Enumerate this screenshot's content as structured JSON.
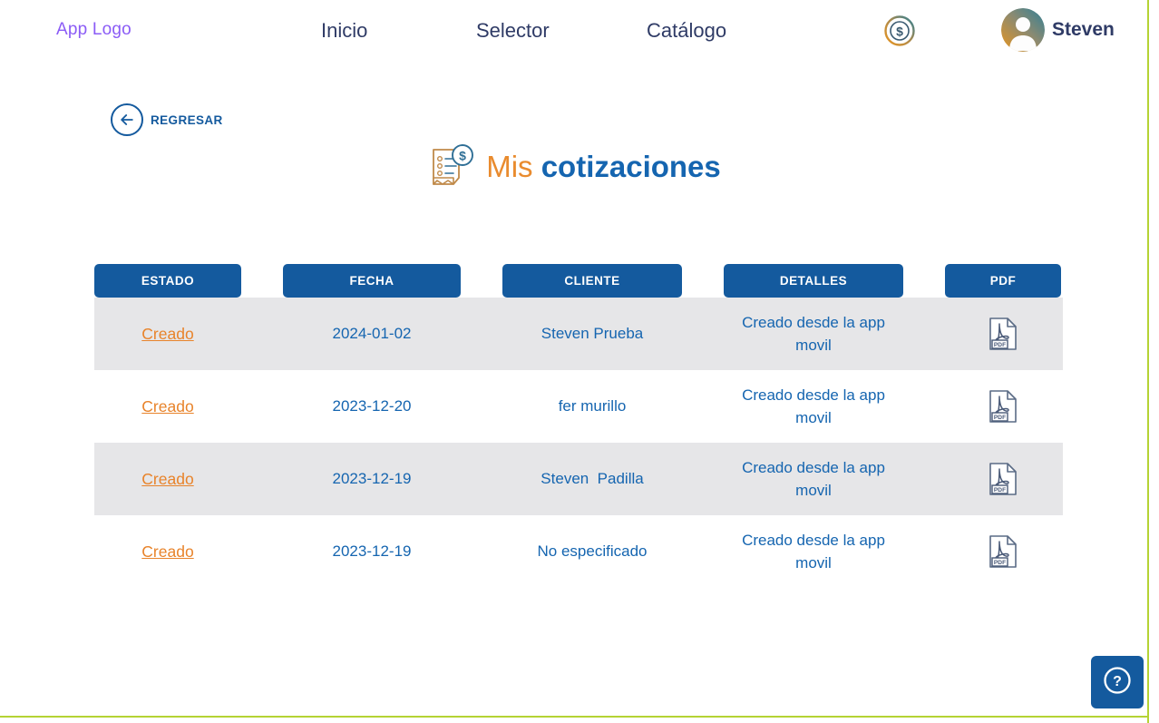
{
  "navbar": {
    "logo": "App Logo",
    "links": [
      {
        "label": "Inicio"
      },
      {
        "label": "Selector"
      },
      {
        "label": "Catálogo"
      }
    ],
    "coin_icon": "dollar-coin-icon",
    "avatar_icon": "user-avatar",
    "user_name": "Steven"
  },
  "back": {
    "label": "REGRESAR",
    "icon": "arrow-left-icon"
  },
  "title": {
    "icon": "invoice-dollar-icon",
    "light": "Mis ",
    "bold": "cotizaciones"
  },
  "table": {
    "headers": [
      {
        "label": "ESTADO"
      },
      {
        "label": "FECHA"
      },
      {
        "label": "CLIENTE"
      },
      {
        "label": "DETALLES"
      },
      {
        "label": "PDF"
      }
    ],
    "rows": [
      {
        "estado": "Creado",
        "fecha": "2024-01-02",
        "cliente": "Steven Prueba",
        "detalles": "Creado desde la app movil",
        "pdf_icon": "pdf-file-icon"
      },
      {
        "estado": "Creado",
        "fecha": "2023-12-20",
        "cliente": "fer murillo",
        "detalles": "Creado desde la app movil",
        "pdf_icon": "pdf-file-icon"
      },
      {
        "estado": "Creado",
        "fecha": "2023-12-19",
        "cliente": "Steven  Padilla",
        "detalles": "Creado desde la app movil",
        "pdf_icon": "pdf-file-icon"
      },
      {
        "estado": "Creado",
        "fecha": "2023-12-19",
        "cliente": "No especificado",
        "detalles": "Creado desde la app movil",
        "pdf_icon": "pdf-file-icon"
      }
    ]
  },
  "help": {
    "icon": "question-mark-icon",
    "label": "?"
  },
  "colors": {
    "brand_blue": "#145a9e",
    "link_blue": "#1565b0",
    "accent_orange": "#e8832a",
    "title_orange": "#e98b2e",
    "logo_purple": "#8b5cf6",
    "nav_text": "#2f3b66",
    "row_stripe": "#e6e6e8",
    "edge_green": "#b5d334"
  }
}
